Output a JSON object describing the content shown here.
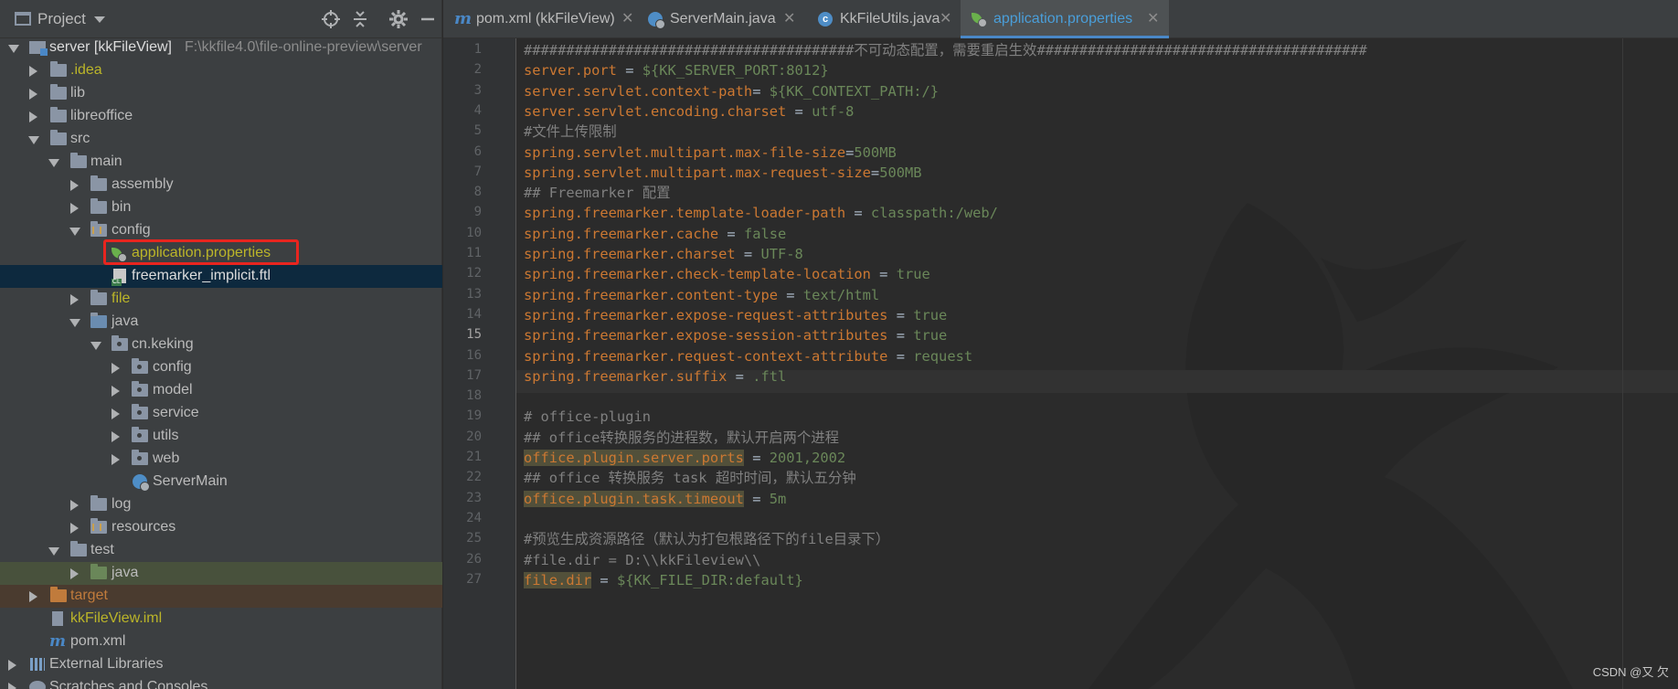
{
  "project": {
    "title": "Project",
    "root_label": "server [kkFileView]",
    "root_path": "F:\\kkfile4.0\\file-online-preview\\server"
  },
  "tree": [
    {
      "label": ".idea"
    },
    {
      "label": "lib"
    },
    {
      "label": "libreoffice"
    },
    {
      "label": "src"
    },
    {
      "label": "main"
    },
    {
      "label": "assembly"
    },
    {
      "label": "bin"
    },
    {
      "label": "config"
    },
    {
      "label": "application.properties"
    },
    {
      "label": "freemarker_implicit.ftl"
    },
    {
      "label": "file"
    },
    {
      "label": "java"
    },
    {
      "label": "cn.keking"
    },
    {
      "label": "config"
    },
    {
      "label": "model"
    },
    {
      "label": "service"
    },
    {
      "label": "utils"
    },
    {
      "label": "web"
    },
    {
      "label": "ServerMain"
    },
    {
      "label": "log"
    },
    {
      "label": "resources"
    },
    {
      "label": "test"
    },
    {
      "label": "java"
    },
    {
      "label": "target"
    },
    {
      "label": "kkFileView.iml"
    },
    {
      "label": "pom.xml"
    },
    {
      "label": "External Libraries"
    },
    {
      "label": "Scratches and Consoles"
    }
  ],
  "tabs": [
    {
      "label": "pom.xml (kkFileView)",
      "icon": "maven-icon"
    },
    {
      "label": "ServerMain.java",
      "icon": "java-class-icon"
    },
    {
      "label": "KkFileUtils.java",
      "icon": "class-icon"
    },
    {
      "label": "application.properties",
      "icon": "spring-properties-icon",
      "active": true
    }
  ],
  "editor": {
    "current_line": 15,
    "lines": [
      {
        "n": "1",
        "parts": [
          [
            "c",
            "#######################################不可动态配置，需要重启生效#######################################"
          ]
        ]
      },
      {
        "n": "2",
        "parts": [
          [
            "k",
            "server.port"
          ],
          [
            "s",
            " = "
          ],
          [
            "v",
            "${KK_SERVER_PORT:8012}"
          ]
        ]
      },
      {
        "n": "3",
        "parts": [
          [
            "k",
            "server.servlet.context-path"
          ],
          [
            "s",
            "= "
          ],
          [
            "v",
            "${KK_CONTEXT_PATH:/}"
          ]
        ]
      },
      {
        "n": "4",
        "parts": [
          [
            "k",
            "server.servlet.encoding.charset"
          ],
          [
            "s",
            " = "
          ],
          [
            "v",
            "utf-8"
          ]
        ]
      },
      {
        "n": "5",
        "parts": [
          [
            "c",
            "#文件上传限制"
          ]
        ]
      },
      {
        "n": "6",
        "parts": [
          [
            "k",
            "spring.servlet.multipart.max-file-size"
          ],
          [
            "s",
            "="
          ],
          [
            "v",
            "500MB"
          ]
        ]
      },
      {
        "n": "7",
        "parts": [
          [
            "k",
            "spring.servlet.multipart.max-request-size"
          ],
          [
            "s",
            "="
          ],
          [
            "v",
            "500MB"
          ]
        ]
      },
      {
        "n": "8",
        "parts": [
          [
            "c",
            "## Freemarker 配置"
          ]
        ]
      },
      {
        "n": "9",
        "parts": [
          [
            "k",
            "spring.freemarker.template-loader-path"
          ],
          [
            "s",
            " = "
          ],
          [
            "v",
            "classpath:/web/"
          ]
        ]
      },
      {
        "n": "10",
        "parts": [
          [
            "k",
            "spring.freemarker.cache"
          ],
          [
            "s",
            " = "
          ],
          [
            "v",
            "false"
          ]
        ]
      },
      {
        "n": "11",
        "parts": [
          [
            "k",
            "spring.freemarker.charset"
          ],
          [
            "s",
            " = "
          ],
          [
            "v",
            "UTF-8"
          ]
        ]
      },
      {
        "n": "12",
        "parts": [
          [
            "k",
            "spring.freemarker.check-template-location"
          ],
          [
            "s",
            " = "
          ],
          [
            "v",
            "true"
          ]
        ]
      },
      {
        "n": "13",
        "parts": [
          [
            "k",
            "spring.freemarker.content-type"
          ],
          [
            "s",
            " = "
          ],
          [
            "v",
            "text/html"
          ]
        ]
      },
      {
        "n": "14",
        "parts": [
          [
            "k",
            "spring.freemarker.expose-request-attributes"
          ],
          [
            "s",
            " = "
          ],
          [
            "v",
            "true"
          ]
        ]
      },
      {
        "n": "15",
        "parts": [
          [
            "k",
            "spring.freemarker.expose-session-attributes"
          ],
          [
            "s",
            " = "
          ],
          [
            "v",
            "true"
          ]
        ]
      },
      {
        "n": "16",
        "parts": [
          [
            "k",
            "spring.freemarker.request-context-attribute"
          ],
          [
            "s",
            " = "
          ],
          [
            "v",
            "request"
          ]
        ]
      },
      {
        "n": "17",
        "parts": [
          [
            "k",
            "spring.freemarker.suffix"
          ],
          [
            "s",
            " = "
          ],
          [
            "v",
            ".ftl"
          ]
        ]
      },
      {
        "n": "18",
        "parts": []
      },
      {
        "n": "19",
        "parts": [
          [
            "c",
            "# office-plugin"
          ]
        ]
      },
      {
        "n": "20",
        "parts": [
          [
            "c",
            "## office转换服务的进程数，默认开启两个进程"
          ]
        ]
      },
      {
        "n": "21",
        "parts": [
          [
            "kh",
            "office.plugin.server.ports"
          ],
          [
            "s",
            " = "
          ],
          [
            "v",
            "2001,2002"
          ]
        ]
      },
      {
        "n": "22",
        "parts": [
          [
            "c",
            "## office 转换服务 task 超时时间，默认五分钟"
          ]
        ]
      },
      {
        "n": "23",
        "parts": [
          [
            "kh",
            "office.plugin.task.timeout"
          ],
          [
            "s",
            " = "
          ],
          [
            "v",
            "5m"
          ]
        ]
      },
      {
        "n": "24",
        "parts": []
      },
      {
        "n": "25",
        "parts": [
          [
            "c",
            "#预览生成资源路径（默认为打包根路径下的file目录下）"
          ]
        ]
      },
      {
        "n": "26",
        "parts": [
          [
            "c",
            "#file.dir = D:\\\\kkFileview\\\\"
          ]
        ]
      },
      {
        "n": "27",
        "parts": [
          [
            "kh",
            "file.dir"
          ],
          [
            "s",
            " = "
          ],
          [
            "v",
            "${KK_FILE_DIR:default}"
          ]
        ]
      }
    ]
  },
  "watermark": "CSDN @又 欠"
}
